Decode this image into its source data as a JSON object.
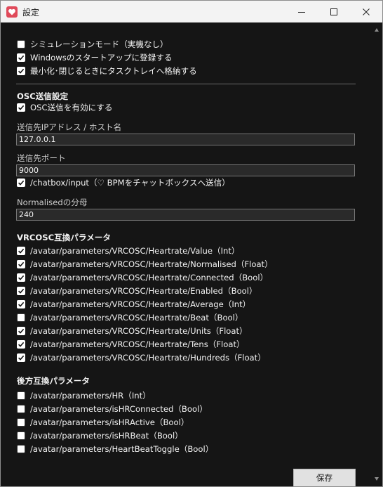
{
  "window": {
    "title": "設定"
  },
  "general": [
    {
      "label": "シミュレーションモード（実機なし）",
      "checked": false
    },
    {
      "label": "Windowsのスタートアップに登録する",
      "checked": true
    },
    {
      "label": "最小化･閉じるときにタスクトレイへ格納する",
      "checked": true
    }
  ],
  "osc": {
    "heading": "OSC送信設定",
    "enable": {
      "label": "OSC送信を有効にする",
      "checked": true
    },
    "host_label": "送信先IPアドレス / ホスト名",
    "host_value": "127.0.0.1",
    "port_label": "送信先ポート",
    "port_value": "9000",
    "chatbox": {
      "label": "/chatbox/input（♡ BPMをチャットボックスへ送信）",
      "checked": true
    },
    "normalised_label": "Normalisedの分母",
    "normalised_value": "240"
  },
  "vrcosc": {
    "heading": "VRCOSC互換パラメータ",
    "items": [
      {
        "label": "/avatar/parameters/VRCOSC/Heartrate/Value（Int）",
        "checked": true
      },
      {
        "label": "/avatar/parameters/VRCOSC/Heartrate/Normalised（Float）",
        "checked": true
      },
      {
        "label": "/avatar/parameters/VRCOSC/Heartrate/Connected（Bool）",
        "checked": true
      },
      {
        "label": "/avatar/parameters/VRCOSC/Heartrate/Enabled（Bool）",
        "checked": true
      },
      {
        "label": "/avatar/parameters/VRCOSC/Heartrate/Average（Int）",
        "checked": true
      },
      {
        "label": "/avatar/parameters/VRCOSC/Heartrate/Beat（Bool）",
        "checked": false
      },
      {
        "label": "/avatar/parameters/VRCOSC/Heartrate/Units（Float）",
        "checked": true
      },
      {
        "label": "/avatar/parameters/VRCOSC/Heartrate/Tens（Float）",
        "checked": true
      },
      {
        "label": "/avatar/parameters/VRCOSC/Heartrate/Hundreds（Float）",
        "checked": true
      }
    ]
  },
  "legacy": {
    "heading": "後方互換パラメータ",
    "items": [
      {
        "label": "/avatar/parameters/HR（Int）",
        "checked": false
      },
      {
        "label": "/avatar/parameters/isHRConnected（Bool）",
        "checked": false
      },
      {
        "label": "/avatar/parameters/isHRActive（Bool）",
        "checked": false
      },
      {
        "label": "/avatar/parameters/isHRBeat（Bool）",
        "checked": false
      },
      {
        "label": "/avatar/parameters/HeartBeatToggle（Bool）",
        "checked": false
      }
    ]
  },
  "footer": {
    "save_label": "保存"
  },
  "icons": {
    "app": "heart-icon",
    "minimize": "minimize-icon",
    "maximize": "maximize-icon",
    "close": "close-icon",
    "check": "check-icon"
  },
  "colors": {
    "app_icon": "#e04a5a",
    "background": "#151515",
    "titlebar": "#f3f3f3"
  }
}
